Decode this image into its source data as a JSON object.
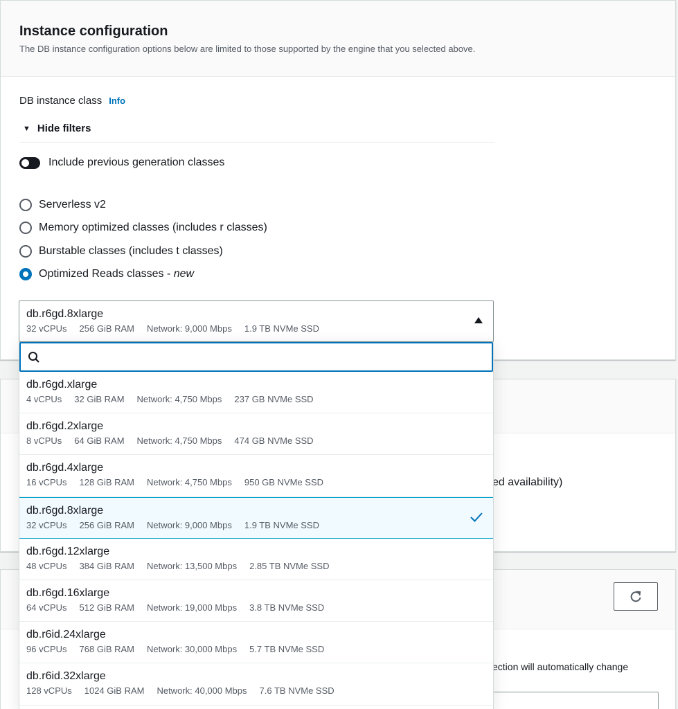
{
  "section": {
    "title": "Instance configuration",
    "description": "The DB instance configuration options below are limited to those supported by the engine that you selected above."
  },
  "db_class": {
    "label": "DB instance class",
    "info": "Info",
    "filters_label": "Hide filters",
    "toggle_label": "Include previous generation classes",
    "toggle_on": false,
    "radios": [
      {
        "label": "Serverless v2",
        "checked": false
      },
      {
        "label": "Memory optimized classes (includes r classes)",
        "checked": false
      },
      {
        "label": "Burstable classes (includes t classes)",
        "checked": false
      },
      {
        "label": "Optimized Reads classes - ",
        "suffix": "new",
        "checked": true
      }
    ]
  },
  "select": {
    "value": "db.r6gd.8xlarge",
    "tags": [
      "32 vCPUs",
      "256 GiB RAM",
      "Network: 9,000 Mbps",
      "1.9 TB NVMe SSD"
    ],
    "search_placeholder": ""
  },
  "options": [
    {
      "name": "db.r6gd.xlarge",
      "tags": [
        "4 vCPUs",
        "32 GiB RAM",
        "Network: 4,750 Mbps",
        "237 GB NVMe SSD"
      ],
      "selected": false
    },
    {
      "name": "db.r6gd.2xlarge",
      "tags": [
        "8 vCPUs",
        "64 GiB RAM",
        "Network: 4,750 Mbps",
        "474 GB NVMe SSD"
      ],
      "selected": false
    },
    {
      "name": "db.r6gd.4xlarge",
      "tags": [
        "16 vCPUs",
        "128 GiB RAM",
        "Network: 4,750 Mbps",
        "950 GB NVMe SSD"
      ],
      "selected": false
    },
    {
      "name": "db.r6gd.8xlarge",
      "tags": [
        "32 vCPUs",
        "256 GiB RAM",
        "Network: 9,000 Mbps",
        "1.9 TB NVMe SSD"
      ],
      "selected": true
    },
    {
      "name": "db.r6gd.12xlarge",
      "tags": [
        "48 vCPUs",
        "384 GiB RAM",
        "Network: 13,500 Mbps",
        "2.85 TB NVMe SSD"
      ],
      "selected": false
    },
    {
      "name": "db.r6gd.16xlarge",
      "tags": [
        "64 vCPUs",
        "512 GiB RAM",
        "Network: 19,000 Mbps",
        "3.8 TB NVMe SSD"
      ],
      "selected": false
    },
    {
      "name": "db.r6id.24xlarge",
      "tags": [
        "96 vCPUs",
        "768 GiB RAM",
        "Network: 30,000 Mbps",
        "5.7 TB NVMe SSD"
      ],
      "selected": false
    },
    {
      "name": "db.r6id.32xlarge",
      "tags": [
        "128 vCPUs",
        "1024 GiB RAM",
        "Network: 40,000 Mbps",
        "7.6 TB NVMe SSD"
      ],
      "selected": false
    }
  ],
  "background": {
    "panel2_text": "ed availability)",
    "panel3_text": "ection will automatically change"
  },
  "colors": {
    "accent": "#0073bb",
    "selected_bg": "#f1faff",
    "selected_border": "#00a1c9"
  }
}
